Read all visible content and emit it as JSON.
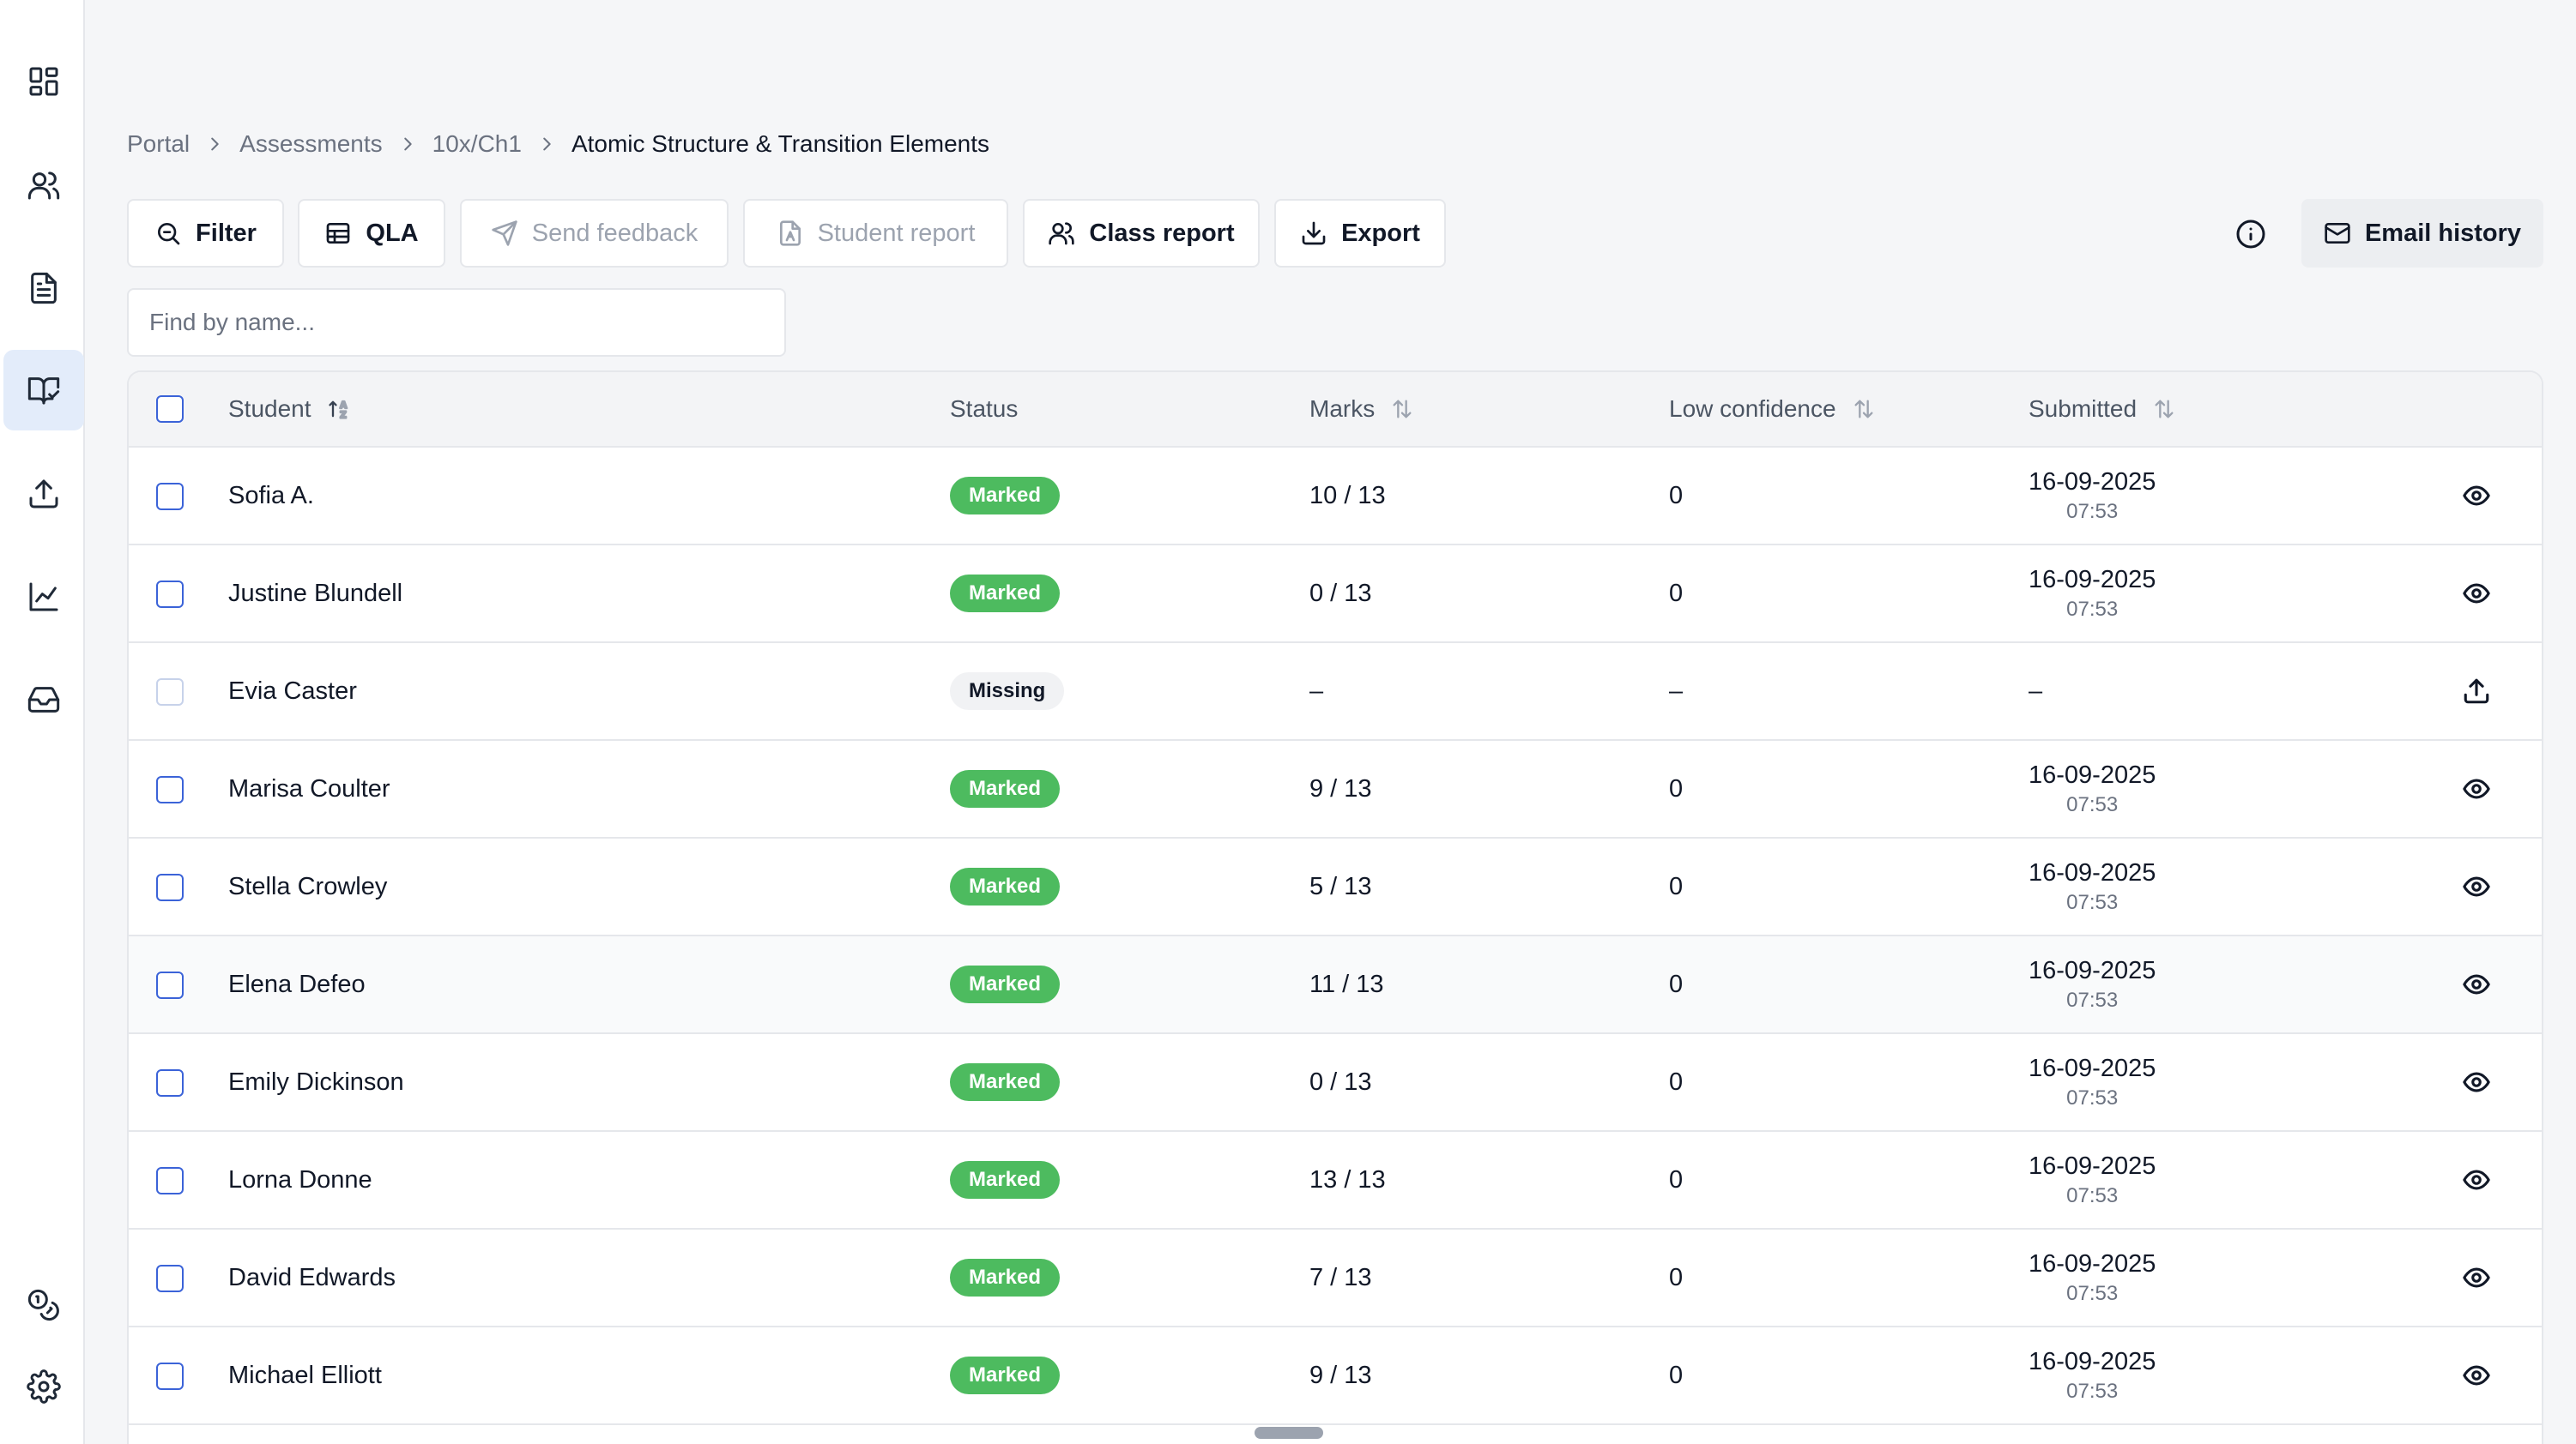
{
  "sidebar": {
    "items": [
      {
        "icon": "dashboard-grid-icon",
        "active": false
      },
      {
        "icon": "users-icon",
        "active": false
      },
      {
        "icon": "document-icon",
        "active": false
      },
      {
        "icon": "book-check-icon",
        "active": true
      },
      {
        "icon": "upload-icon",
        "active": false
      },
      {
        "icon": "line-chart-icon",
        "active": false
      },
      {
        "icon": "inbox-icon",
        "active": false
      }
    ],
    "bottom_items": [
      {
        "icon": "coins-icon"
      },
      {
        "icon": "settings-gear-icon"
      }
    ]
  },
  "breadcrumb": {
    "items": [
      "Portal",
      "Assessments",
      "10x/Ch1"
    ],
    "current": "Atomic Structure & Transition Elements"
  },
  "toolbar": {
    "filter": "Filter",
    "qla": "QLA",
    "send_feedback": "Send feedback",
    "student_report": "Student report",
    "class_report": "Class report",
    "export": "Export",
    "email_history": "Email history"
  },
  "search": {
    "placeholder": "Find by name...",
    "value": ""
  },
  "table": {
    "columns": {
      "student": "Student",
      "status": "Status",
      "marks": "Marks",
      "low_confidence": "Low confidence",
      "submitted": "Submitted"
    },
    "rows": [
      {
        "name": "Sofia A.",
        "status": "Marked",
        "marks": "10 / 13",
        "low_confidence": "0",
        "date": "16-09-2025",
        "time": "07:53",
        "action": "view-eye-icon"
      },
      {
        "name": "Justine Blundell",
        "status": "Marked",
        "marks": "0 / 13",
        "low_confidence": "0",
        "date": "16-09-2025",
        "time": "07:53",
        "action": "view-eye-icon"
      },
      {
        "name": "Evia Caster",
        "status": "Missing",
        "marks": "–",
        "low_confidence": "–",
        "date": "–",
        "time": "",
        "action": "upload-icon"
      },
      {
        "name": "Marisa Coulter",
        "status": "Marked",
        "marks": "9 / 13",
        "low_confidence": "0",
        "date": "16-09-2025",
        "time": "07:53",
        "action": "view-eye-icon"
      },
      {
        "name": "Stella Crowley",
        "status": "Marked",
        "marks": "5 / 13",
        "low_confidence": "0",
        "date": "16-09-2025",
        "time": "07:53",
        "action": "view-eye-icon"
      },
      {
        "name": "Elena Defeo",
        "status": "Marked",
        "marks": "11 / 13",
        "low_confidence": "0",
        "date": "16-09-2025",
        "time": "07:53",
        "action": "view-eye-icon"
      },
      {
        "name": "Emily Dickinson",
        "status": "Marked",
        "marks": "0 / 13",
        "low_confidence": "0",
        "date": "16-09-2025",
        "time": "07:53",
        "action": "view-eye-icon"
      },
      {
        "name": "Lorna Donne",
        "status": "Marked",
        "marks": "13 / 13",
        "low_confidence": "0",
        "date": "16-09-2025",
        "time": "07:53",
        "action": "view-eye-icon"
      },
      {
        "name": "David Edwards",
        "status": "Marked",
        "marks": "7 / 13",
        "low_confidence": "0",
        "date": "16-09-2025",
        "time": "07:53",
        "action": "view-eye-icon"
      },
      {
        "name": "Michael Elliott",
        "status": "Marked",
        "marks": "9 / 13",
        "low_confidence": "0",
        "date": "16-09-2025",
        "time": "07:53",
        "action": "view-eye-icon"
      }
    ]
  },
  "colors": {
    "accent": "#3b63d8",
    "marked_badge": "#4dbb5f",
    "active_nav": "#e3ecfa"
  }
}
